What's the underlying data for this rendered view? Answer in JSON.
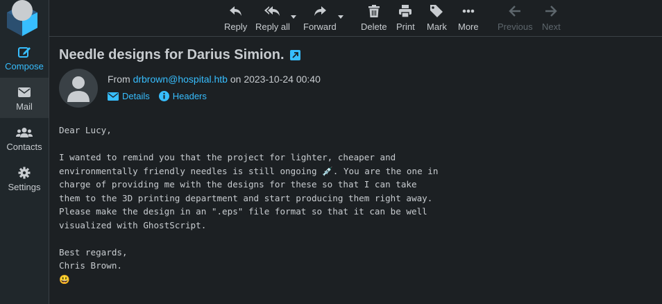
{
  "colors": {
    "accent": "#37beff",
    "bg": "#1c2023",
    "sidebar": "#20272b",
    "text": "#c8ccd0",
    "disabled": "#5d666c"
  },
  "sidebar": {
    "items": [
      {
        "label": "Compose",
        "icon": "compose-icon"
      },
      {
        "label": "Mail",
        "icon": "envelope-icon"
      },
      {
        "label": "Contacts",
        "icon": "users-icon"
      },
      {
        "label": "Settings",
        "icon": "gear-icon"
      }
    ]
  },
  "toolbar": {
    "reply": "Reply",
    "reply_all": "Reply all",
    "forward": "Forward",
    "delete": "Delete",
    "print": "Print",
    "mark": "Mark",
    "more": "More",
    "previous": "Previous",
    "next": "Next"
  },
  "message": {
    "subject": "Needle designs for Darius Simion.",
    "from_label": "From",
    "from_email": "drbrown@hospital.htb",
    "on_label": "on",
    "date": "2023-10-24 00:40",
    "details": "Details",
    "headers": "Headers",
    "body": "Dear Lucy,\n\nI wanted to remind you that the project for lighter, cheaper and\nenvironmentally friendly needles is still ongoing 💉. You are the one in\ncharge of providing me with the designs for these so that I can take\nthem to the 3D printing department and start producing them right away.\nPlease make the design in an \".eps\" file format so that it can be well\nvisualized with GhostScript.\n\nBest regards,\nChris Brown.\n😃"
  }
}
